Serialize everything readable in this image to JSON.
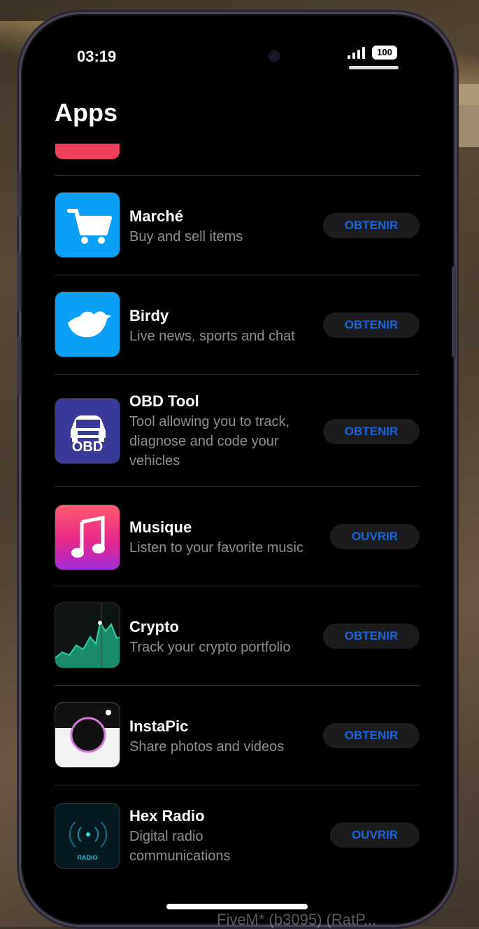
{
  "status_bar": {
    "time": "03:19",
    "battery": "100"
  },
  "page": {
    "title": "Apps"
  },
  "apps": [
    {
      "name": "Marché",
      "desc": "Buy and sell items",
      "button": "OBTENIR",
      "icon": "cart-icon"
    },
    {
      "name": "Birdy",
      "desc": "Live news, sports and chat",
      "button": "OBTENIR",
      "icon": "bird-icon"
    },
    {
      "name": "OBD Tool",
      "desc": "Tool allowing you to track, diagnose and code your vehicles",
      "button": "OBTENIR",
      "icon": "car-obd-icon",
      "icon_label": "OBD"
    },
    {
      "name": "Musique",
      "desc": "Listen to your favorite music",
      "button": "OUVRIR",
      "icon": "music-note-icon"
    },
    {
      "name": "Crypto",
      "desc": "Track your crypto portfolio",
      "button": "OBTENIR",
      "icon": "chart-icon"
    },
    {
      "name": "InstaPic",
      "desc": "Share photos and videos",
      "button": "OBTENIR",
      "icon": "camera-icon"
    },
    {
      "name": "Hex Radio",
      "desc": "Digital radio communications",
      "button": "OUVRIR",
      "icon": "radio-icon",
      "icon_label": "RADIO"
    }
  ],
  "watermark": "FiveM* (b3095) (RatP...",
  "colors": {
    "accent": "#1a63d8",
    "pill_bg": "#1c1c1e",
    "desc_text": "#8e8e93"
  }
}
